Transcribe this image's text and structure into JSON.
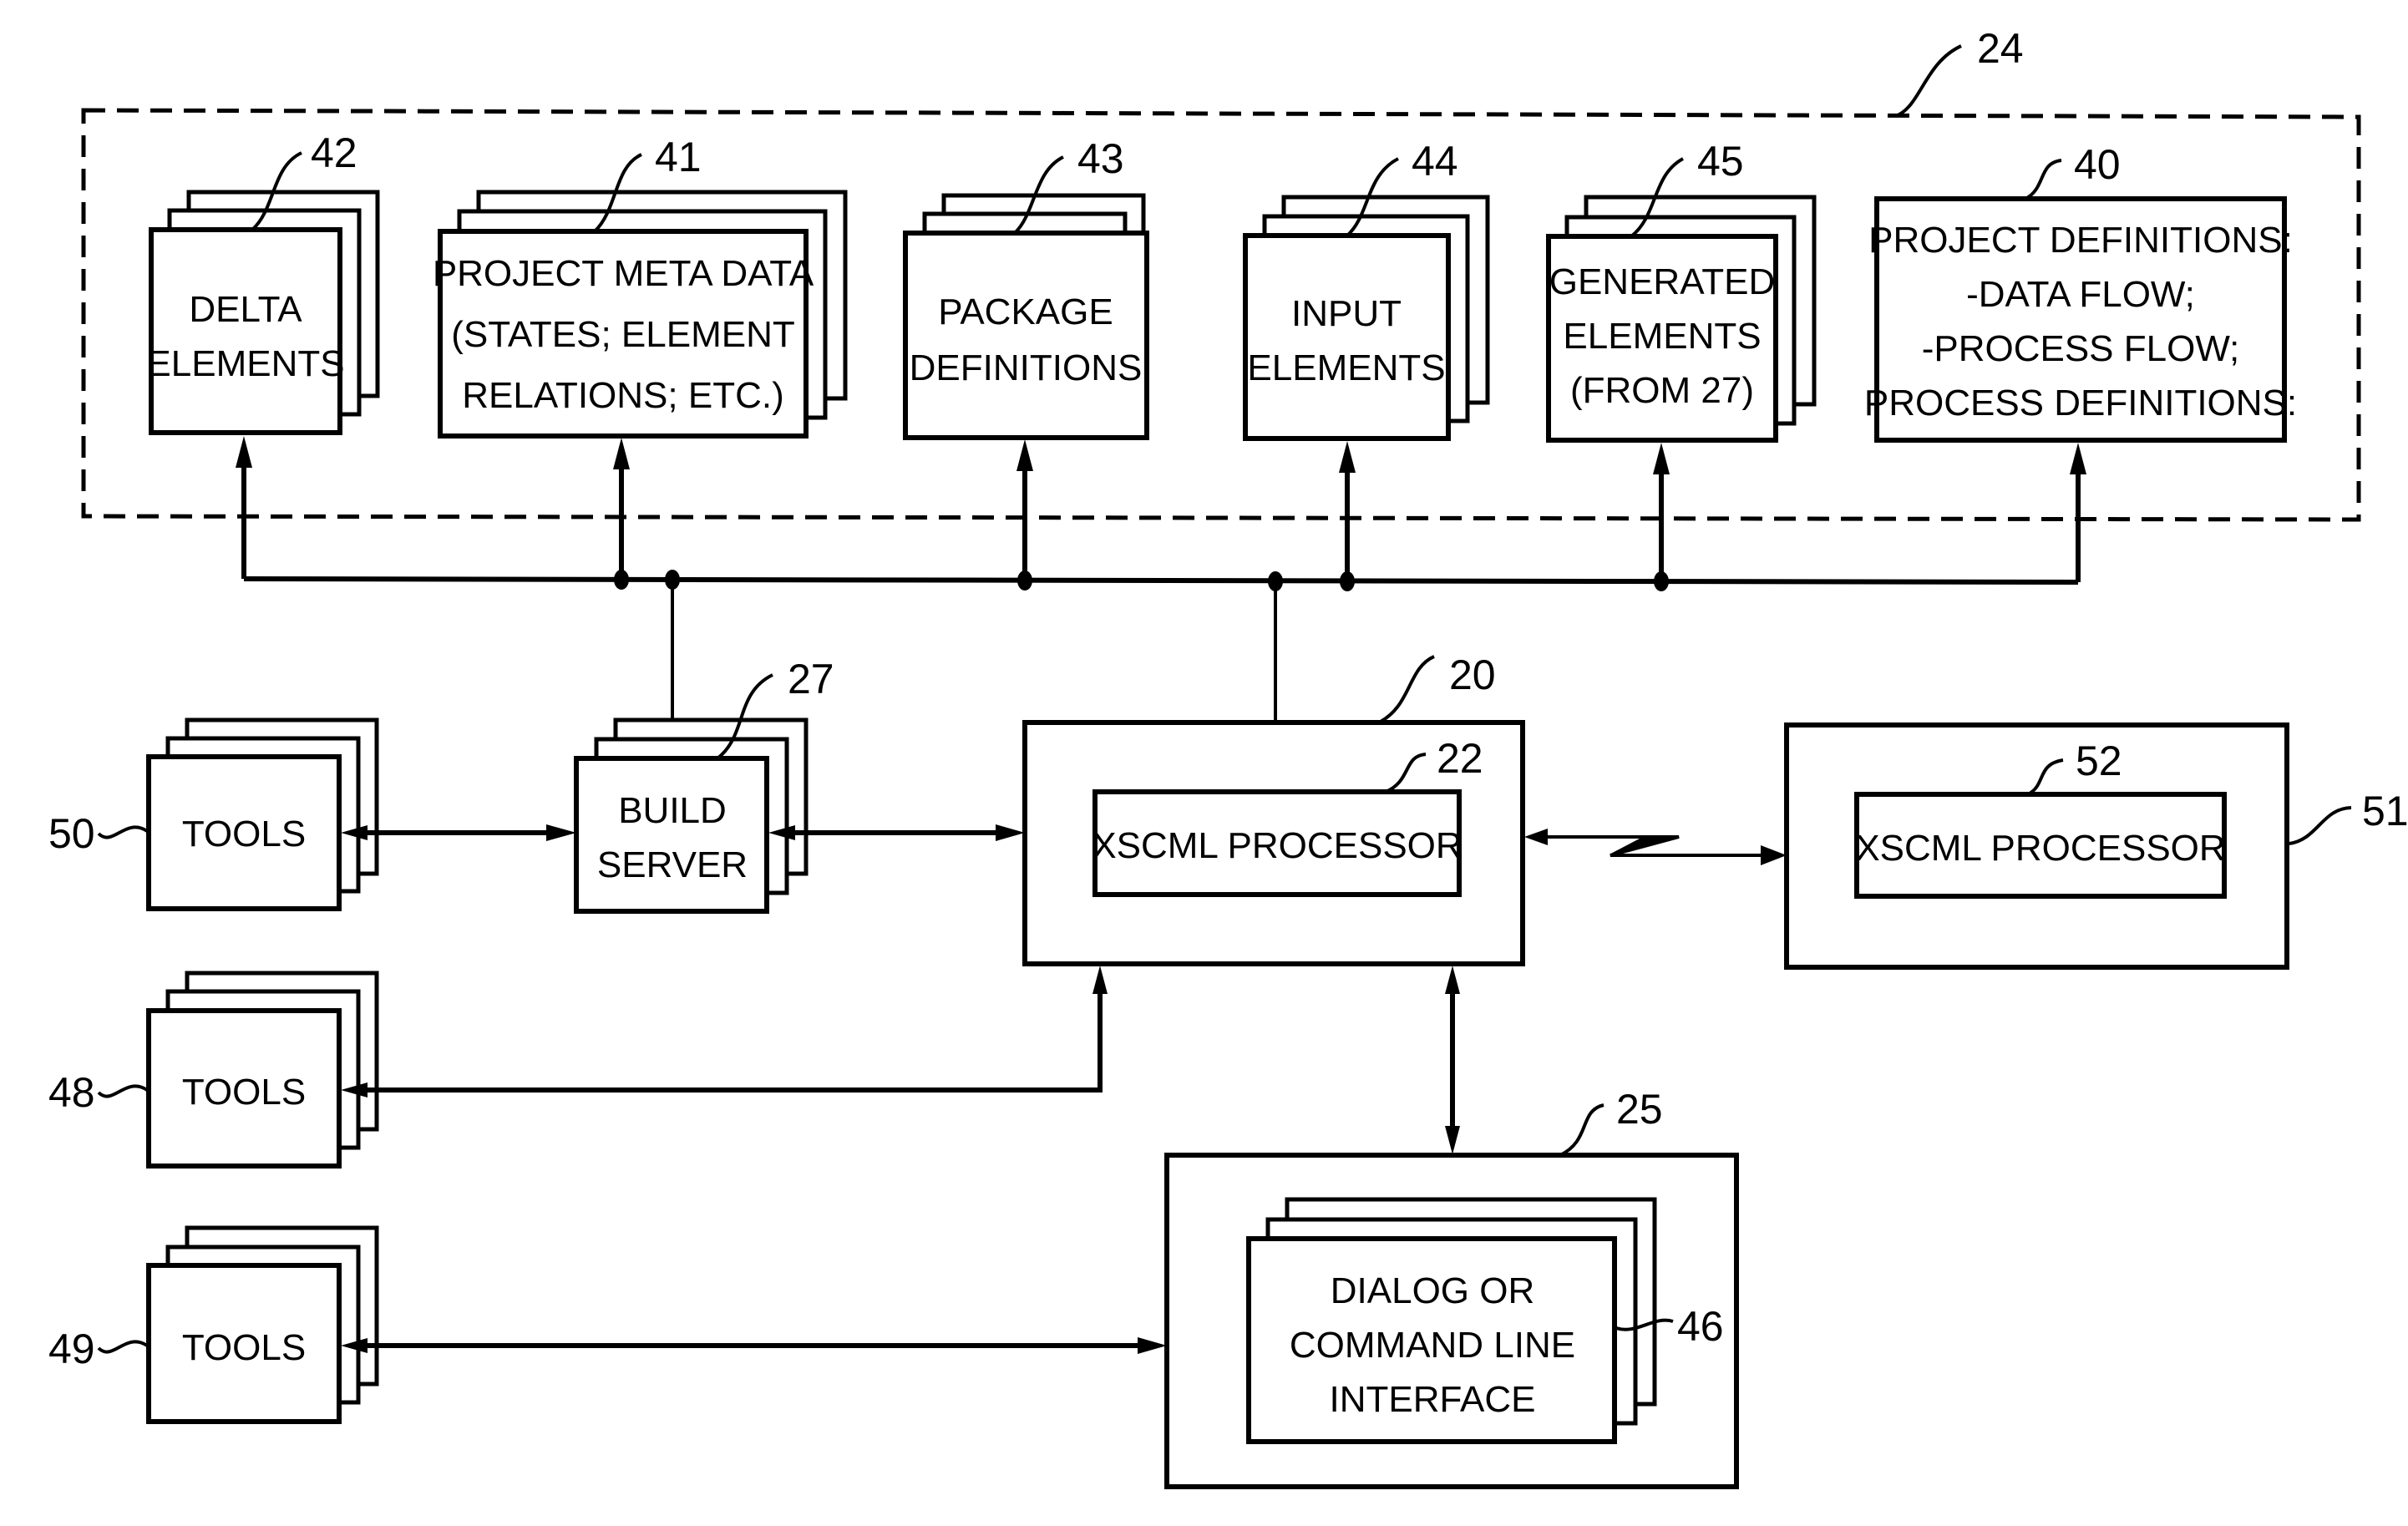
{
  "figure": {
    "repository_ref": "24",
    "repository_elements": [
      {
        "id": "delta",
        "ref": "42",
        "lines": [
          "DELTA",
          "ELEMENTS"
        ],
        "stacked": true
      },
      {
        "id": "meta",
        "ref": "41",
        "lines": [
          "PROJECT META DATA",
          "(STATES; ELEMENT",
          "RELATIONS; ETC.)"
        ],
        "stacked": true
      },
      {
        "id": "package",
        "ref": "43",
        "lines": [
          "PACKAGE",
          "DEFINITIONS"
        ],
        "stacked": true
      },
      {
        "id": "input",
        "ref": "44",
        "lines": [
          "INPUT",
          "ELEMENTS"
        ],
        "stacked": true
      },
      {
        "id": "generated",
        "ref": "45",
        "lines": [
          "GENERATED",
          "ELEMENTS",
          "(FROM 27)"
        ],
        "stacked": true
      },
      {
        "id": "projdefs",
        "ref": "40",
        "lines": [
          "PROJECT DEFINITIONS:",
          "-DATA FLOW;",
          "-PROCESS FLOW;",
          "PROCESS DEFINITIONS:"
        ],
        "stacked": false
      }
    ],
    "build_server": {
      "ref": "27",
      "lines": [
        "BUILD",
        "SERVER"
      ]
    },
    "host": {
      "ref": "20",
      "processor": {
        "ref": "22",
        "label": "XSCML PROCESSOR"
      }
    },
    "remote_host": {
      "ref": "51",
      "processor": {
        "ref": "52",
        "label": "XSCML PROCESSOR"
      }
    },
    "interface_host": {
      "ref": "25",
      "interface": {
        "ref": "46",
        "lines": [
          "DIALOG OR",
          "COMMAND LINE",
          "INTERFACE"
        ]
      }
    },
    "tools": [
      {
        "ref": "50",
        "label": "TOOLS"
      },
      {
        "ref": "48",
        "label": "TOOLS"
      },
      {
        "ref": "49",
        "label": "TOOLS"
      }
    ]
  }
}
